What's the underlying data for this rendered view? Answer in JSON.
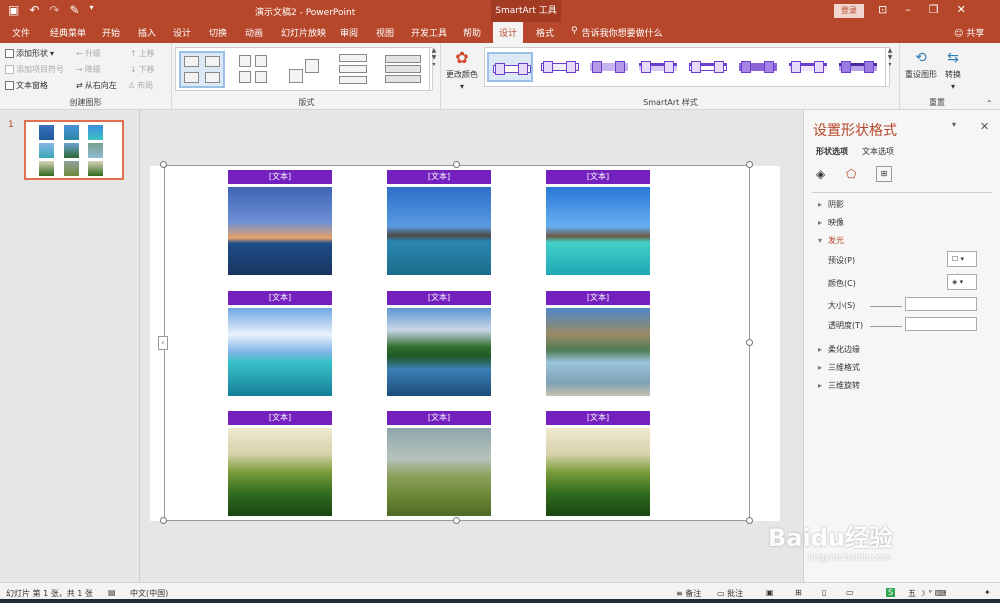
{
  "window": {
    "doc_title": "演示文稿2 - PowerPoint",
    "context_tools": "SmartArt 工具",
    "login": "登录",
    "share": "共享",
    "tell_me": "告诉我你想要做什么"
  },
  "tabs": [
    {
      "label": "文件"
    },
    {
      "label": "经典菜单"
    },
    {
      "label": "开始"
    },
    {
      "label": "插入"
    },
    {
      "label": "设计"
    },
    {
      "label": "切换"
    },
    {
      "label": "动画"
    },
    {
      "label": "幻灯片放映"
    },
    {
      "label": "审阅"
    },
    {
      "label": "视图"
    },
    {
      "label": "开发工具"
    },
    {
      "label": "帮助"
    },
    {
      "label": "设计"
    },
    {
      "label": "格式"
    }
  ],
  "ribbon": {
    "create_graphic": {
      "label": "创建图形",
      "add_shape": "添加形状",
      "add_bullet": "添加项目符号",
      "text_pane": "文本窗格",
      "promote": "升级",
      "demote": "降级",
      "right_to_left": "从右向左",
      "move_up": "上移",
      "move_down": "下移",
      "layout": "布局"
    },
    "layouts": {
      "label": "版式"
    },
    "styles": {
      "label": "SmartArt 样式",
      "change_colors": "更改颜色"
    },
    "reset": {
      "label": "重置",
      "reset_graphic": "重设图形",
      "convert": "转换"
    }
  },
  "thumbnail": {
    "number": "1"
  },
  "smartart": {
    "items": [
      {
        "label": "[文本]",
        "scene": "overwater-bungalow-dusk"
      },
      {
        "label": "[文本]",
        "scene": "overwater-villas-day"
      },
      {
        "label": "[文本]",
        "scene": "overwater-villas-lagoon"
      },
      {
        "label": "[文本]",
        "scene": "pier-clouds"
      },
      {
        "label": "[文本]",
        "scene": "mountain-lake-forest"
      },
      {
        "label": "[文本]",
        "scene": "mountain-lake-reflection"
      },
      {
        "label": "[文本]",
        "scene": "green-hills"
      },
      {
        "label": "[文本]",
        "scene": "wheat-field-tree"
      },
      {
        "label": "[文本]",
        "scene": "green-hills"
      }
    ],
    "label_color": "#7320bf"
  },
  "task_pane": {
    "title": "设置形状格式",
    "tab_shape": "形状选项",
    "tab_text": "文本选项",
    "sections": {
      "shadow": "阴影",
      "reflection": "映像",
      "glow": "发光",
      "soft_edges": "柔化边缘",
      "format_3d": "三维格式",
      "rotation_3d": "三维旋转"
    },
    "glow_fields": {
      "preset": "预设(P)",
      "color": "颜色(C)",
      "size": "大小(S)",
      "transparency": "透明度(T)"
    }
  },
  "status": {
    "slide_info": "幻灯片 第 1 张，共 1 张",
    "language": "中文(中国)",
    "notes": "备注",
    "comments": "批注"
  },
  "watermark": {
    "brand": "Baidu经验",
    "url": "jingyan.baidu.com"
  },
  "colors": {
    "accent": "#b7472a",
    "smartart_label": "#7320bf"
  }
}
